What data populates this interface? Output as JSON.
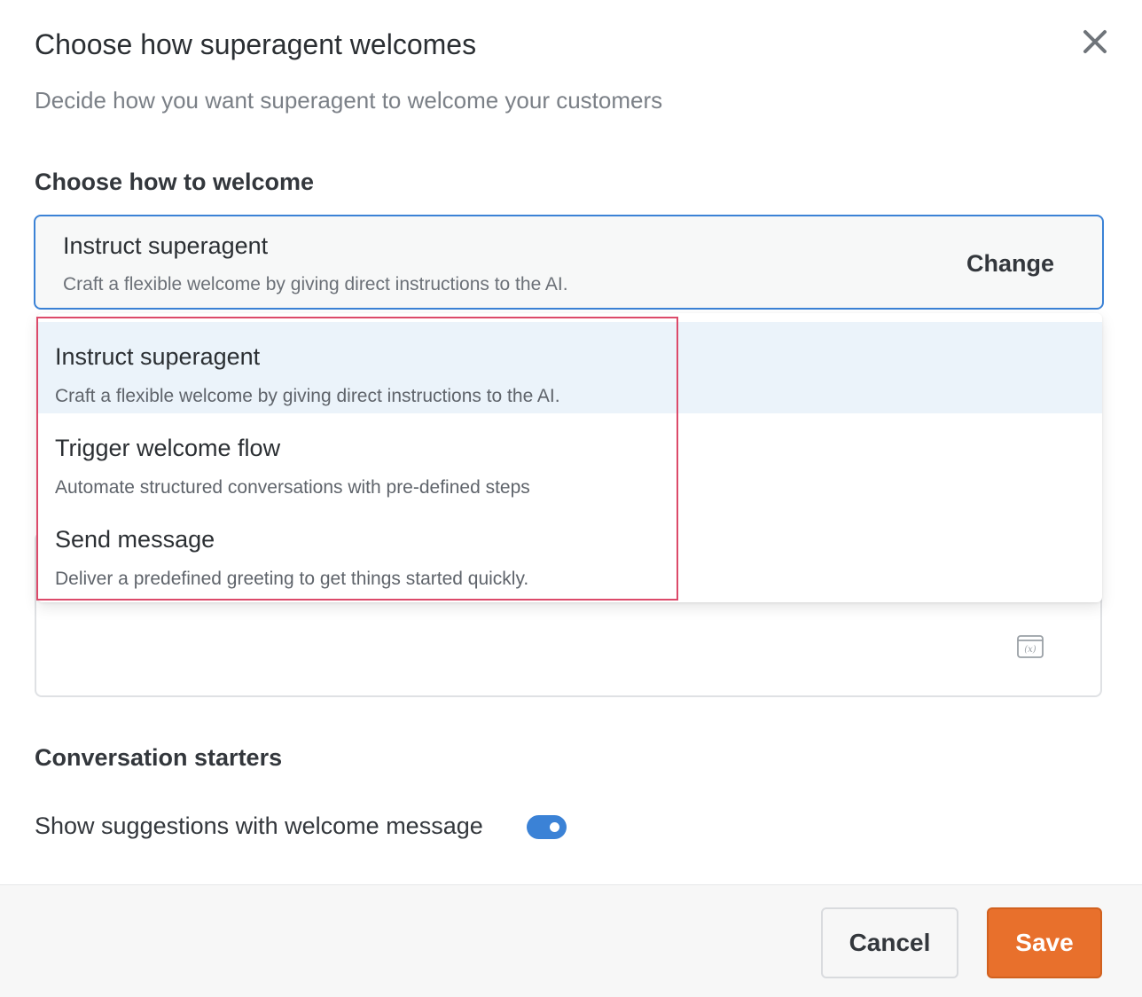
{
  "dialog": {
    "title": "Choose how superagent welcomes",
    "subtitle": "Decide how you want superagent to welcome your customers",
    "close_icon": "close-icon"
  },
  "welcome": {
    "section_label": "Choose how to welcome",
    "selected": {
      "title": "Instruct superagent",
      "description": "Craft a flexible welcome by giving direct instructions to the AI."
    },
    "change_label": "Change",
    "options": [
      {
        "title": "Instruct superagent",
        "description": "Craft a flexible welcome by giving direct instructions to the AI.",
        "selected": true
      },
      {
        "title": "Trigger welcome flow",
        "description": "Automate structured conversations with pre-defined steps",
        "selected": false
      },
      {
        "title": "Send message",
        "description": "Deliver a predefined greeting to get things started quickly.",
        "selected": false
      }
    ]
  },
  "editor": {
    "variable_icon": "variable-icon"
  },
  "starters": {
    "section_label": "Conversation starters",
    "toggle_label": "Show suggestions with welcome message",
    "toggle_on": true
  },
  "footer": {
    "cancel_label": "Cancel",
    "save_label": "Save"
  },
  "colors": {
    "accent": "#3b82d6",
    "save": "#e8702c",
    "highlight": "#dc4a6a",
    "selected_bg": "#ebf3fa"
  }
}
